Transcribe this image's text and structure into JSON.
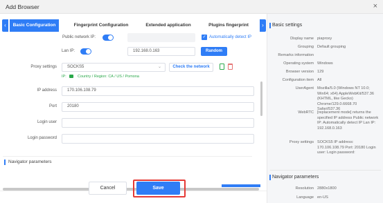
{
  "window": {
    "title": "Add Browser",
    "close_icon": "×"
  },
  "tabs": [
    "Basic Configuration",
    "Fingerprint Configuration",
    "Extended application",
    "Plugins fingerprint"
  ],
  "form": {
    "public_ip_label": "Public network IP:",
    "auto_detect_label": "Automatically detect IP",
    "lan_ip_label": "Lan IP:",
    "lan_ip_value": "192.168.0.163",
    "random_button": "Random",
    "proxy_settings_label": "Proxy settings",
    "proxy_type": "SOCKS5",
    "check_network_button": "Check the network",
    "ip_info_prefix": "IP:",
    "ip_info_region": "Country / Region: CA / US / Pomona",
    "ip_address_label": "IP address",
    "ip_address_value": "170.106.108.79",
    "port_label": "Port",
    "port_value": "20180",
    "login_user_label": "Login user",
    "login_password_label": "Login password",
    "navigator_section": "Navigator parameters"
  },
  "footer": {
    "cancel": "Cancel",
    "save": "Save"
  },
  "summary": {
    "basic_title": "Basic settings",
    "rows": [
      {
        "k": "Display name",
        "v": "piaproxy"
      },
      {
        "k": "Grouping",
        "v": "Default grouping"
      },
      {
        "k": "Remarks information",
        "v": ""
      },
      {
        "k": "Operating system",
        "v": "Windows"
      },
      {
        "k": "Browser version",
        "v": "129"
      },
      {
        "k": "Configuration item",
        "v": "All"
      },
      {
        "k": "UserAgent",
        "v": "Mozilla/5.0 (Windows NT 10.0; Win64; x64) AppleWebKit/537.36 (KHTML, like Gecko) Chrome/129.0.6668.70 Safari/537.36"
      },
      {
        "k": "WebRTC",
        "v": "[replacement mode] returns the specified IP address Public network IP: Automatically detect IP Lan IP: 192.168.0.163"
      },
      {
        "k": "Proxy settings",
        "v": "SOCKS5 IP address: 170.106.108.79 Port: 20180 Login user: Login password:"
      }
    ],
    "nav_title": "Navigator parameters",
    "nav_rows": [
      {
        "k": "Resolution",
        "v": "2880x1800"
      },
      {
        "k": "Language",
        "v": "en-US"
      }
    ]
  },
  "colors": {
    "accent": "#2f7df6",
    "highlight": "#e53935",
    "ok": "#2aa84a"
  }
}
